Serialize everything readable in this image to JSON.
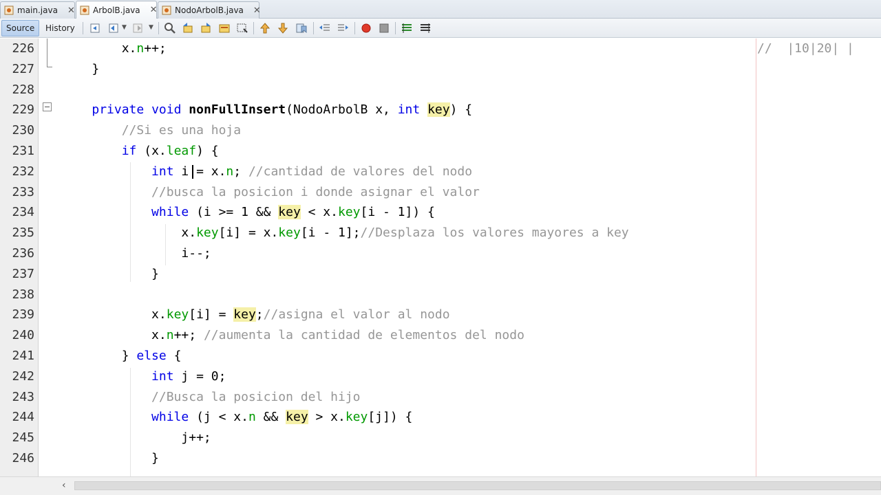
{
  "tabs": [
    {
      "label": "main.java",
      "active": false
    },
    {
      "label": "ArbolB.java",
      "active": true
    },
    {
      "label": "NodoArbolB.java",
      "active": false
    }
  ],
  "toolbar": {
    "source_label": "Source",
    "history_label": "History",
    "icons": [
      "last-edit-icon",
      "back-icon",
      "forward-icon",
      "find-icon",
      "find-previous-icon",
      "find-next-icon",
      "toggle-highlight-icon",
      "toggle-rect-select-icon",
      "previous-bookmark-icon",
      "next-bookmark-icon",
      "toggle-bookmark-icon",
      "shift-left-icon",
      "shift-right-icon",
      "start-macro-icon",
      "stop-macro-icon",
      "comment-icon",
      "uncomment-icon"
    ]
  },
  "editor": {
    "margin_comment": "//  |10|20| |",
    "lines": [
      {
        "num": "226",
        "tokens": [
          [
            "        ",
            ""
          ],
          [
            "x.",
            ""
          ],
          [
            "n",
            "fld"
          ],
          [
            "++;",
            ""
          ]
        ]
      },
      {
        "num": "227",
        "tokens": [
          [
            "    }",
            ""
          ]
        ]
      },
      {
        "num": "228",
        "tokens": []
      },
      {
        "num": "229",
        "tokens": [
          [
            "    ",
            ""
          ],
          [
            "private",
            "kw"
          ],
          [
            " ",
            ""
          ],
          [
            "void",
            "kw"
          ],
          [
            " ",
            ""
          ],
          [
            "nonFullInsert",
            "fn"
          ],
          [
            "(NodoArbolB x, ",
            ""
          ],
          [
            "int",
            "kw"
          ],
          [
            " ",
            ""
          ],
          [
            "key",
            "hl"
          ],
          [
            ") {",
            ""
          ]
        ]
      },
      {
        "num": "230",
        "tokens": [
          [
            "        ",
            ""
          ],
          [
            "//Si es una hoja",
            "cm"
          ]
        ]
      },
      {
        "num": "231",
        "tokens": [
          [
            "        ",
            ""
          ],
          [
            "if",
            "kw"
          ],
          [
            " (x.",
            ""
          ],
          [
            "leaf",
            "fld"
          ],
          [
            ") {",
            ""
          ]
        ]
      },
      {
        "num": "232",
        "tokens": [
          [
            "            ",
            ""
          ],
          [
            "int",
            "kw"
          ],
          [
            " i = x.",
            ""
          ],
          [
            "n",
            "fld"
          ],
          [
            "; ",
            ""
          ],
          [
            "//cantidad de valores del nodo",
            "cm"
          ]
        ]
      },
      {
        "num": "233",
        "tokens": [
          [
            "            ",
            ""
          ],
          [
            "//busca la posicion i donde asignar el valor",
            "cm"
          ]
        ]
      },
      {
        "num": "234",
        "tokens": [
          [
            "            ",
            ""
          ],
          [
            "while",
            "kw"
          ],
          [
            " (i >= 1 && ",
            ""
          ],
          [
            "key",
            "hl"
          ],
          [
            " < x.",
            ""
          ],
          [
            "key",
            "fld"
          ],
          [
            "[i - 1]) {",
            ""
          ]
        ]
      },
      {
        "num": "235",
        "tokens": [
          [
            "                ",
            ""
          ],
          [
            "x.",
            ""
          ],
          [
            "key",
            "fld"
          ],
          [
            "[i] = x.",
            ""
          ],
          [
            "key",
            "fld"
          ],
          [
            "[i - 1];",
            ""
          ],
          [
            "//Desplaza los valores mayores a key",
            "cm"
          ]
        ]
      },
      {
        "num": "236",
        "tokens": [
          [
            "                ",
            ""
          ],
          [
            "i--;",
            ""
          ]
        ]
      },
      {
        "num": "237",
        "tokens": [
          [
            "            }",
            ""
          ]
        ]
      },
      {
        "num": "238",
        "tokens": []
      },
      {
        "num": "239",
        "tokens": [
          [
            "            ",
            ""
          ],
          [
            "x.",
            ""
          ],
          [
            "key",
            "fld"
          ],
          [
            "[i] = ",
            ""
          ],
          [
            "key",
            "hl"
          ],
          [
            ";",
            ""
          ],
          [
            "//asigna el valor al nodo",
            "cm"
          ]
        ]
      },
      {
        "num": "240",
        "tokens": [
          [
            "            ",
            ""
          ],
          [
            "x.",
            ""
          ],
          [
            "n",
            "fld"
          ],
          [
            "++; ",
            ""
          ],
          [
            "//aumenta la cantidad de elementos del nodo",
            "cm"
          ]
        ]
      },
      {
        "num": "241",
        "tokens": [
          [
            "        } ",
            ""
          ],
          [
            "else",
            "kw"
          ],
          [
            " {",
            ""
          ]
        ]
      },
      {
        "num": "242",
        "tokens": [
          [
            "            ",
            ""
          ],
          [
            "int",
            "kw"
          ],
          [
            " j = 0;",
            ""
          ]
        ]
      },
      {
        "num": "243",
        "tokens": [
          [
            "            ",
            ""
          ],
          [
            "//Busca la posicion del hijo",
            "cm"
          ]
        ]
      },
      {
        "num": "244",
        "tokens": [
          [
            "            ",
            ""
          ],
          [
            "while",
            "kw"
          ],
          [
            " (j < x.",
            ""
          ],
          [
            "n",
            "fld"
          ],
          [
            " && ",
            ""
          ],
          [
            "key",
            "hl"
          ],
          [
            " > x.",
            ""
          ],
          [
            "key",
            "fld"
          ],
          [
            "[j]) {",
            ""
          ]
        ]
      },
      {
        "num": "245",
        "tokens": [
          [
            "                ",
            ""
          ],
          [
            "j++;",
            ""
          ]
        ]
      },
      {
        "num": "246",
        "tokens": [
          [
            "            }",
            ""
          ]
        ]
      }
    ]
  }
}
